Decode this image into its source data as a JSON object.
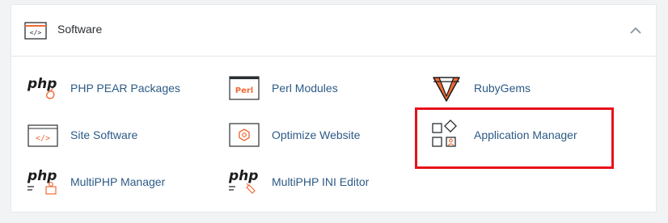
{
  "section": {
    "title": "Software",
    "icon": "code-window-icon",
    "collapse_icon": "chevron-up-icon"
  },
  "items": [
    {
      "label": "PHP PEAR Packages",
      "icon": "php-pear-icon"
    },
    {
      "label": "Perl Modules",
      "icon": "perl-icon"
    },
    {
      "label": "RubyGems",
      "icon": "ruby-gem-icon"
    },
    {
      "label": "Site Software",
      "icon": "code-window-icon"
    },
    {
      "label": "Optimize Website",
      "icon": "hexagon-gear-icon"
    },
    {
      "label": "Application Manager",
      "icon": "apps-grid-icon"
    },
    {
      "label": "MultiPHP Manager",
      "icon": "php-manager-icon"
    },
    {
      "label": "MultiPHP INI Editor",
      "icon": "php-ini-icon"
    }
  ],
  "colors": {
    "link": "#2c5a86",
    "accent_orange": "#f06a35",
    "highlight_red": "#e8101a"
  },
  "php_text": "php",
  "perl_badge": "Perl"
}
